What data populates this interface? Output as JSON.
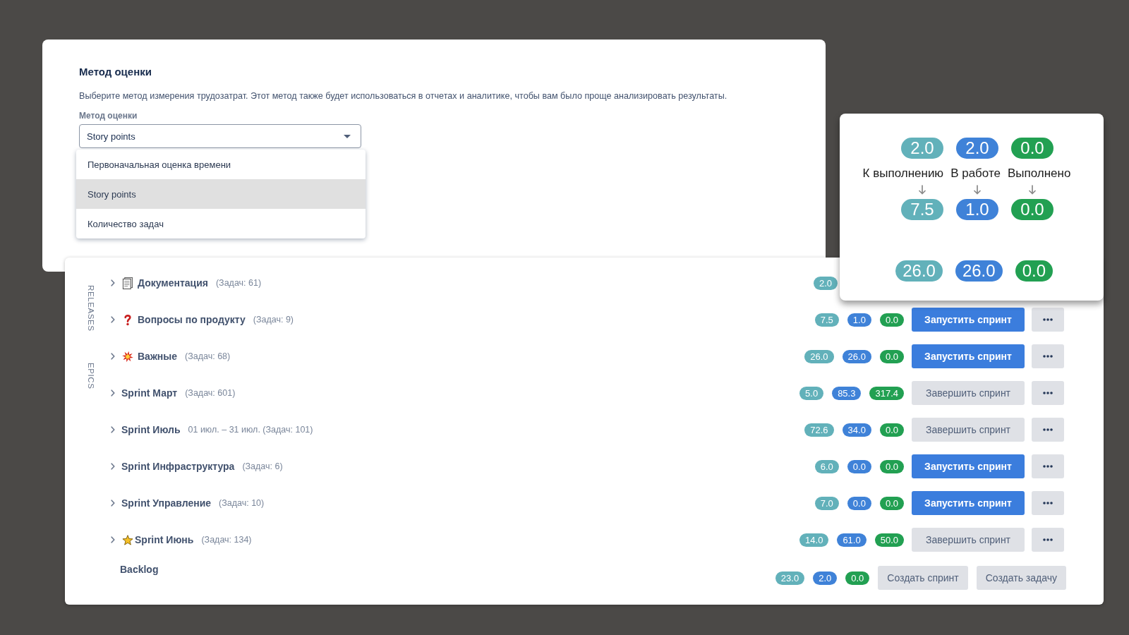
{
  "estimation_settings": {
    "title": "Метод оценки",
    "description": "Выберите метод измерения трудозатрат. Этот метод также будет использоваться в отчетах и аналитике, чтобы вам было проще анализировать результаты.",
    "field_label": "Метод оценки",
    "select": {
      "value": "Story points",
      "expanded": true
    },
    "options": [
      {
        "label": "Первоначальная оценка времени",
        "selected": false
      },
      {
        "label": "Story points",
        "selected": true
      },
      {
        "label": "Количество задач",
        "selected": false
      }
    ]
  },
  "side_tabs": [
    {
      "label": "RELEASES"
    },
    {
      "label": "EPICS"
    }
  ],
  "sprints": [
    {
      "kind": "document",
      "name": "Документация",
      "meta": "(Задач: 61)",
      "expanded": false,
      "estimates": [
        {
          "value": "2.0",
          "color": "#62b1ba"
        }
      ]
    },
    {
      "kind": "question",
      "name": "Вопросы по продукту",
      "meta": "(Задач: 9)",
      "expanded": false,
      "estimates": [
        {
          "value": "7.5",
          "color": "#62b1ba"
        },
        {
          "value": "1.0",
          "color": "#3f82d8"
        },
        {
          "value": "0.0",
          "color": "#22a052"
        }
      ],
      "action": {
        "label": "Запустить спринт",
        "kind": "primary"
      }
    },
    {
      "kind": "burst",
      "name": "Важные",
      "meta": "(Задач: 68)",
      "expanded": false,
      "estimates": [
        {
          "value": "26.0",
          "color": "#62b1ba"
        },
        {
          "value": "26.0",
          "color": "#3f82d8"
        },
        {
          "value": "0.0",
          "color": "#22a052"
        }
      ],
      "action": {
        "label": "Запустить спринт",
        "kind": "primary"
      }
    },
    {
      "kind": "plain",
      "name": "Sprint Март",
      "meta": "(Задач: 601)",
      "expanded": false,
      "estimates": [
        {
          "value": "5.0",
          "color": "#62b1ba"
        },
        {
          "value": "85.3",
          "color": "#3f82d8"
        },
        {
          "value": "317.4",
          "color": "#22a052"
        }
      ],
      "action": {
        "label": "Завершить спринт",
        "kind": "secondary"
      }
    },
    {
      "kind": "plain",
      "name": "Sprint Июль",
      "meta": "01 июл. – 31 июл. (Задач: 101)",
      "expanded": false,
      "estimates": [
        {
          "value": "72.6",
          "color": "#62b1ba"
        },
        {
          "value": "34.0",
          "color": "#3f82d8"
        },
        {
          "value": "0.0",
          "color": "#22a052"
        }
      ],
      "action": {
        "label": "Завершить спринт",
        "kind": "secondary"
      }
    },
    {
      "kind": "plain",
      "name": "Sprint Инфраструктура",
      "meta": "(Задач: 6)",
      "expanded": false,
      "estimates": [
        {
          "value": "6.0",
          "color": "#62b1ba"
        },
        {
          "value": "0.0",
          "color": "#3f82d8"
        },
        {
          "value": "0.0",
          "color": "#22a052"
        }
      ],
      "action": {
        "label": "Запустить спринт",
        "kind": "primary"
      }
    },
    {
      "kind": "plain",
      "name": "Sprint Управление",
      "meta": "(Задач: 10)",
      "expanded": false,
      "estimates": [
        {
          "value": "7.0",
          "color": "#62b1ba"
        },
        {
          "value": "0.0",
          "color": "#3f82d8"
        },
        {
          "value": "0.0",
          "color": "#22a052"
        }
      ],
      "action": {
        "label": "Запустить спринт",
        "kind": "primary"
      }
    },
    {
      "kind": "star",
      "name": "Sprint Июнь",
      "meta": "(Задач: 134)",
      "expanded": false,
      "estimates": [
        {
          "value": "14.0",
          "color": "#62b1ba"
        },
        {
          "value": "61.0",
          "color": "#3f82d8"
        },
        {
          "value": "50.0",
          "color": "#22a052"
        }
      ],
      "action": {
        "label": "Завершить спринт",
        "kind": "secondary"
      }
    }
  ],
  "backlog": {
    "name": "Backlog",
    "estimates": [
      {
        "value": "23.0",
        "color": "#62b1ba"
      },
      {
        "value": "2.0",
        "color": "#3f82d8"
      },
      {
        "value": "0.0",
        "color": "#22a052"
      }
    ],
    "buttons": [
      {
        "label": "Создать спринт"
      },
      {
        "label": "Создать задачу"
      }
    ]
  },
  "estimate_legend": {
    "columns": [
      {
        "before": "2.0",
        "label": "К выполнению",
        "after": "7.5",
        "color": "#62b1ba"
      },
      {
        "before": "2.0",
        "label": "В работе",
        "after": "1.0",
        "color": "#3f82d8"
      },
      {
        "before": "0.0",
        "label": "Выполнено",
        "after": "0.0",
        "color": "#22a052"
      }
    ],
    "totals": [
      {
        "value": "26.0",
        "color": "#62b1ba"
      },
      {
        "value": "26.0",
        "color": "#3f82d8"
      },
      {
        "value": "0.0",
        "color": "#22a052"
      }
    ]
  }
}
